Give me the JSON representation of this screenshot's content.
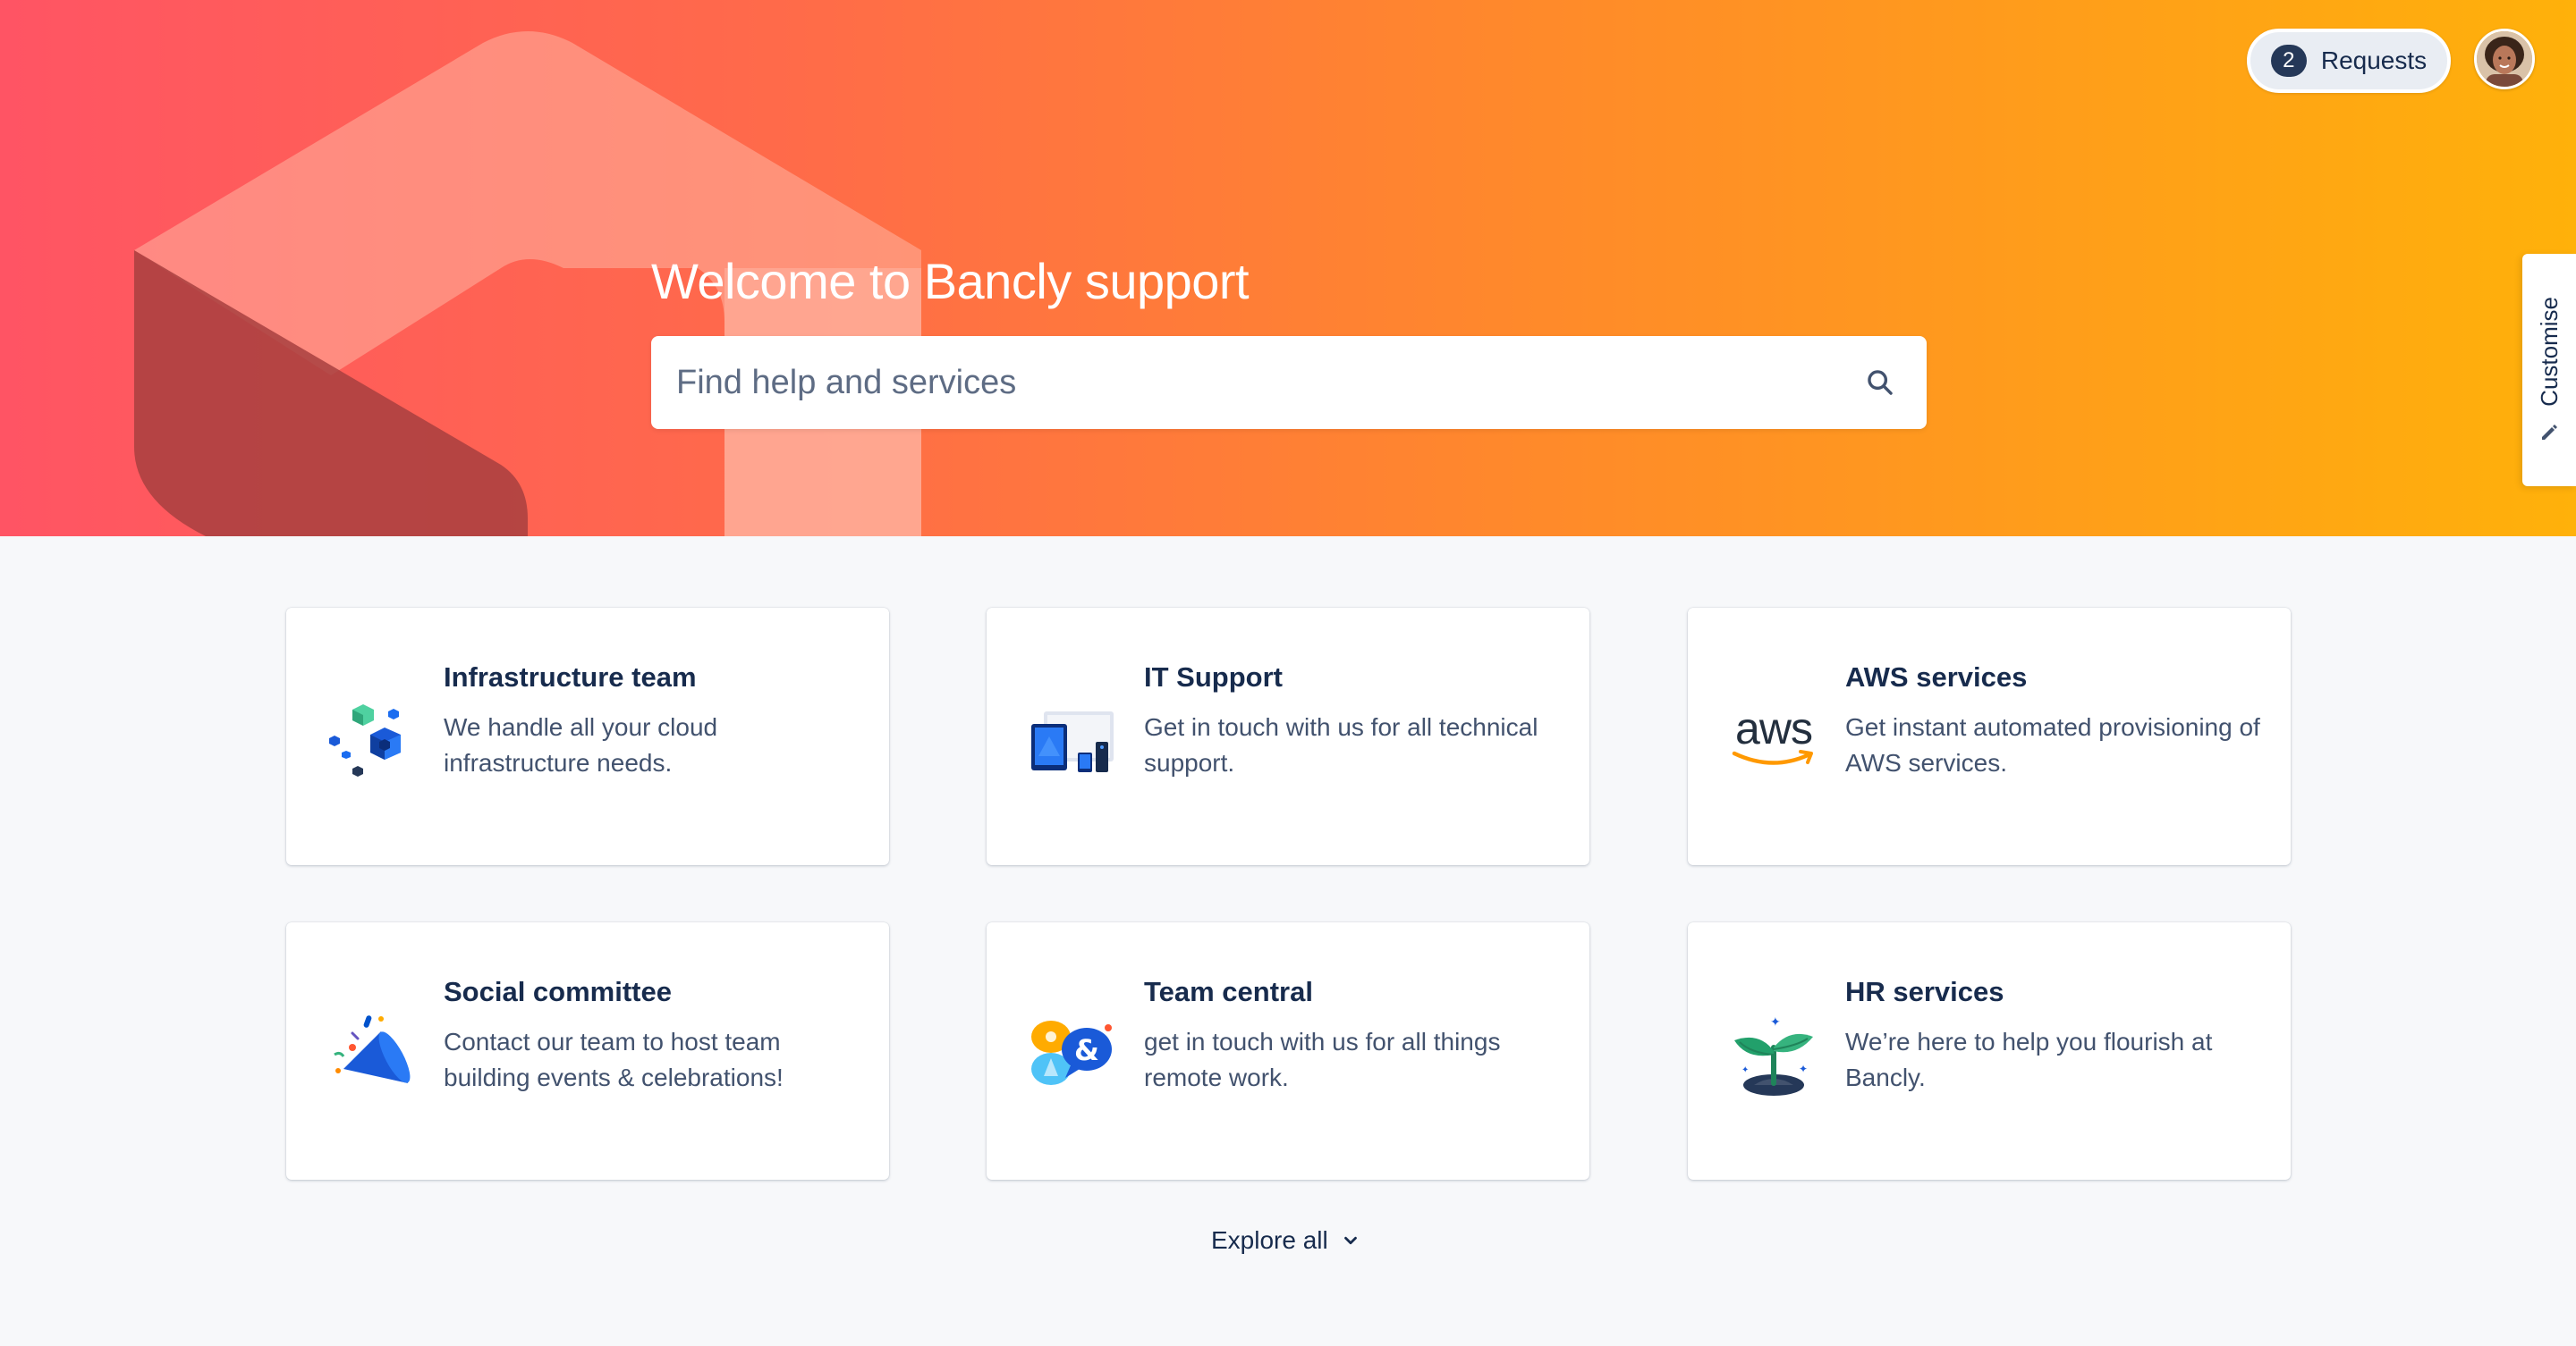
{
  "hero": {
    "title": "Welcome to Bancly support",
    "search_placeholder": "Find help and services"
  },
  "header": {
    "requests_count": "2",
    "requests_label": "Requests",
    "customise_label": "Customise"
  },
  "cards": [
    {
      "title": "Infrastructure team",
      "description": "We handle all your cloud infrastructure needs.",
      "icon": "cubes-icon"
    },
    {
      "title": "IT Support",
      "description": "Get in touch with us for all technical support.",
      "icon": "devices-icon"
    },
    {
      "title": "AWS services",
      "description": "Get instant automated provisioning of AWS services.",
      "icon": "aws-logo-icon",
      "logo_text": "aws"
    },
    {
      "title": "Social committee",
      "description": "Contact our team to host team building events & celebrations!",
      "icon": "party-popper-icon"
    },
    {
      "title": "Team central",
      "description": "get in touch with us for all things remote work.",
      "icon": "chat-bubbles-icon"
    },
    {
      "title": "HR services",
      "description": "We’re here to help you flourish at Bancly.",
      "icon": "sprout-icon"
    }
  ],
  "footer": {
    "explore_all_label": "Explore all"
  },
  "colors": {
    "hero_start": "#ff5464",
    "hero_end": "#ffb10a",
    "text_primary": "#172b4d",
    "text_secondary": "#42526e"
  }
}
